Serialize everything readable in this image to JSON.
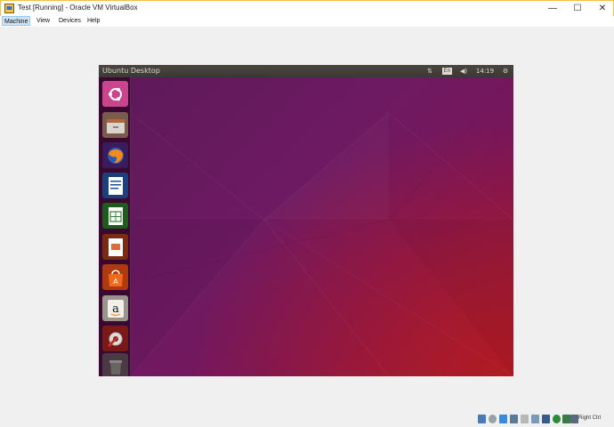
{
  "window": {
    "title": "Test [Running] - Oracle VM VirtualBox",
    "controls": {
      "minimize": "—",
      "maximize": "☐",
      "close": "✕"
    }
  },
  "menu": [
    "Machine",
    "View",
    "Devices",
    "Help"
  ],
  "guest": {
    "panel_title": "Ubuntu Desktop",
    "indicators": {
      "network": "⇅",
      "keyboard": "En",
      "sound": "◀)",
      "clock": "14:19",
      "session": "⚙"
    },
    "launcher": [
      {
        "name": "dash-icon",
        "color": "#c9468e"
      },
      {
        "name": "files-icon",
        "color": "#8e6a58"
      },
      {
        "name": "firefox-icon",
        "color": "#3a1b5c"
      },
      {
        "name": "writer-icon",
        "color": "#1d4f9b"
      },
      {
        "name": "calc-icon",
        "color": "#2e8a2e"
      },
      {
        "name": "impress-icon",
        "color": "#b0401f"
      },
      {
        "name": "software-center-icon",
        "color": "#e0521d"
      },
      {
        "name": "amazon-icon",
        "color": "#d6d2cc"
      },
      {
        "name": "system-settings-icon",
        "color": "#c2302a"
      },
      {
        "name": "trash-icon",
        "color": "#5a4a55"
      }
    ]
  },
  "statusbar": {
    "host_key": "Right Ctrl",
    "icons": [
      "hard-disk-icon",
      "optical-drive-icon",
      "audio-icon",
      "network-icon",
      "usb-icon",
      "shared-folder-icon",
      "display-icon",
      "video-capture-icon",
      "cpu-icon",
      "mouse-integration-icon"
    ]
  }
}
